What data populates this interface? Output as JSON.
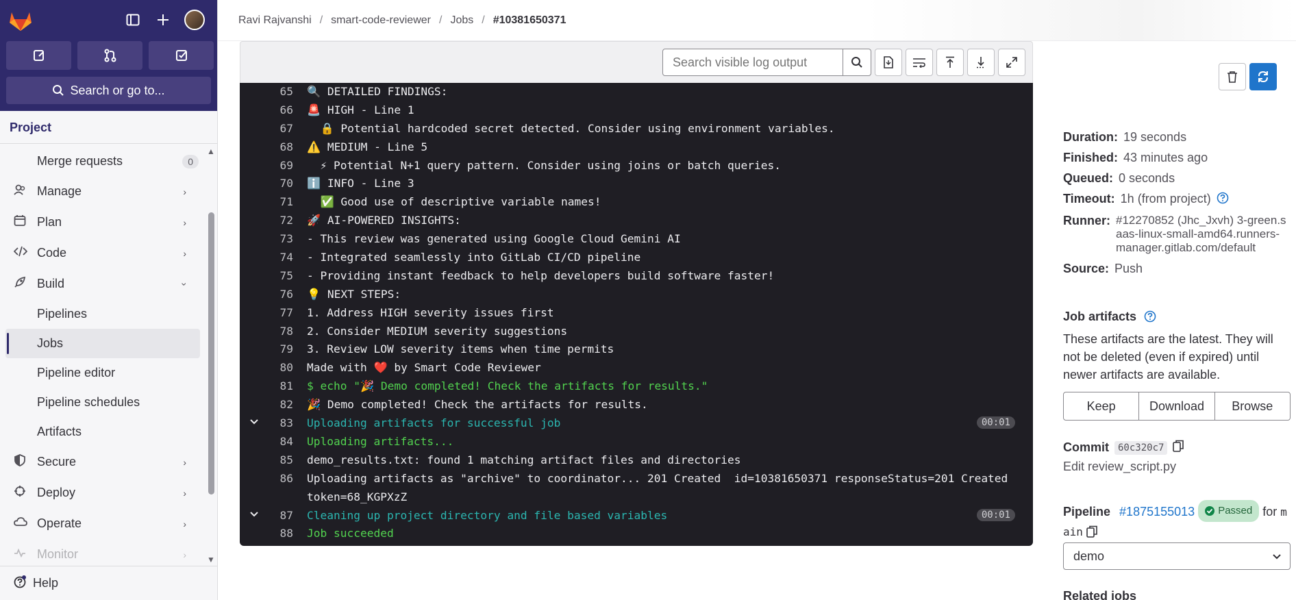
{
  "breadcrumb": [
    "Ravi Rajvanshi",
    "smart-code-reviewer",
    "Jobs",
    "#10381650371"
  ],
  "sidebar": {
    "search_label": "Search or go to...",
    "project_label": "Project",
    "merge_requests": {
      "label": "Merge requests",
      "count": "0"
    },
    "groups": [
      {
        "label": "Manage"
      },
      {
        "label": "Plan"
      },
      {
        "label": "Code"
      },
      {
        "label": "Build"
      }
    ],
    "build_items": [
      "Pipelines",
      "Jobs",
      "Pipeline editor",
      "Pipeline schedules",
      "Artifacts"
    ],
    "lower_groups": [
      {
        "label": "Secure"
      },
      {
        "label": "Deploy"
      },
      {
        "label": "Operate"
      },
      {
        "label": "Monitor"
      }
    ],
    "help_label": "Help"
  },
  "log": {
    "search_placeholder": "Search visible log output",
    "lines": [
      {
        "n": "65",
        "t": "🔍 DETAILED FINDINGS:"
      },
      {
        "n": "66",
        "t": "🚨 HIGH - Line 1"
      },
      {
        "n": "67",
        "t": "  🔒 Potential hardcoded secret detected. Consider using environment variables."
      },
      {
        "n": "68",
        "t": "⚠️ MEDIUM - Line 5"
      },
      {
        "n": "69",
        "t": "  ⚡ Potential N+1 query pattern. Consider using joins or batch queries."
      },
      {
        "n": "70",
        "t": "ℹ️ INFO - Line 3"
      },
      {
        "n": "71",
        "t": "  ✅ Good use of descriptive variable names!"
      },
      {
        "n": "72",
        "t": "🚀 AI-POWERED INSIGHTS:"
      },
      {
        "n": "73",
        "t": "- This review was generated using Google Cloud Gemini AI"
      },
      {
        "n": "74",
        "t": "- Integrated seamlessly into GitLab CI/CD pipeline"
      },
      {
        "n": "75",
        "t": "- Providing instant feedback to help developers build software faster!"
      },
      {
        "n": "76",
        "t": "💡 NEXT STEPS:"
      },
      {
        "n": "77",
        "t": "1. Address HIGH severity issues first"
      },
      {
        "n": "78",
        "t": "2. Consider MEDIUM severity suggestions"
      },
      {
        "n": "79",
        "t": "3. Review LOW severity items when time permits"
      },
      {
        "n": "80",
        "t": "Made with ❤️ by Smart Code Reviewer"
      },
      {
        "n": "81",
        "t": "$ echo \"🎉 Demo completed! Check the artifacts for results.\""
      },
      {
        "n": "82",
        "t": "🎉 Demo completed! Check the artifacts for results."
      },
      {
        "n": "83",
        "t": "Uploading artifacts for successful job",
        "dur": "00:01"
      },
      {
        "n": "84",
        "t": "Uploading artifacts..."
      },
      {
        "n": "85",
        "t": "demo_results.txt: found 1 matching artifact files and directories"
      },
      {
        "n": "86",
        "t": "Uploading artifacts as \"archive\" to coordinator... 201 Created  id=10381650371 responseStatus=201 Created token=68_KGPXzZ"
      },
      {
        "n": "87",
        "t": "Cleaning up project directory and file based variables",
        "dur": "00:01"
      },
      {
        "n": "88",
        "t": "Job succeeded"
      }
    ]
  },
  "job": {
    "duration": {
      "key": "Duration:",
      "value": "19 seconds"
    },
    "finished": {
      "key": "Finished:",
      "value": "43 minutes ago"
    },
    "queued": {
      "key": "Queued:",
      "value": "0 seconds"
    },
    "timeout": {
      "key": "Timeout:",
      "value": "1h (from project)"
    },
    "runner": {
      "key": "Runner:",
      "value": "#12270852 (Jhc_Jxvh) 3-green.saas-linux-small-amd64.runners-manager.gitlab.com/default"
    },
    "source": {
      "key": "Source:",
      "value": "Push"
    }
  },
  "artifacts": {
    "title": "Job artifacts",
    "text": "These artifacts are the latest. They will not be deleted (even if expired) until newer artifacts are available.",
    "keep": "Keep",
    "download": "Download",
    "browse": "Browse"
  },
  "commit": {
    "label": "Commit",
    "sha": "60c320c7",
    "message": "Edit review_script.py"
  },
  "pipeline": {
    "label": "Pipeline",
    "id": "#1875155013",
    "status": "Passed",
    "for": "for",
    "ref_a": "m",
    "ref_b": "ain"
  },
  "stage_select": "demo",
  "related_jobs": "Related jobs",
  "colors": {
    "sidebar_top": "#2f2a6b",
    "log_bg": "#1f1e24",
    "green": "#52d34f",
    "cyan": "#2bb6b0",
    "accent": "#1f75cb"
  }
}
